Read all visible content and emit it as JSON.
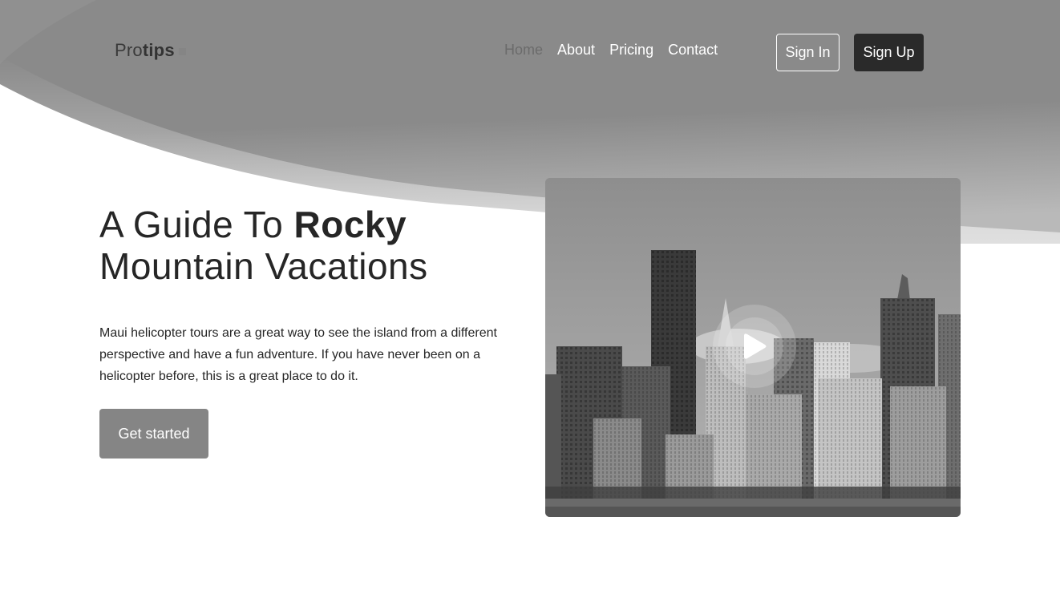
{
  "header": {
    "logo": {
      "thin": "Pro",
      "bold": "tips"
    },
    "nav": [
      {
        "label": "Home",
        "active": true
      },
      {
        "label": "About",
        "active": false
      },
      {
        "label": "Pricing",
        "active": false
      },
      {
        "label": "Contact",
        "active": false
      }
    ],
    "sign_in_label": "Sign In",
    "sign_up_label": "Sign Up"
  },
  "hero": {
    "title_part1": "A Guide To ",
    "title_bold": "Rocky",
    "title_part2": "Mountain Vacations",
    "description": "Maui helicopter tours are a great way to see the island from a different perspective and have a fun adventure. If you have never been on a helicopter before, this is a great place to do it.",
    "cta_label": "Get started"
  },
  "colors": {
    "header_gray": "#858585",
    "dark_button": "#2a2a2a",
    "text": "#262626"
  },
  "icons": {
    "video_play": "play-icon",
    "logo_mark": "square-icon"
  }
}
